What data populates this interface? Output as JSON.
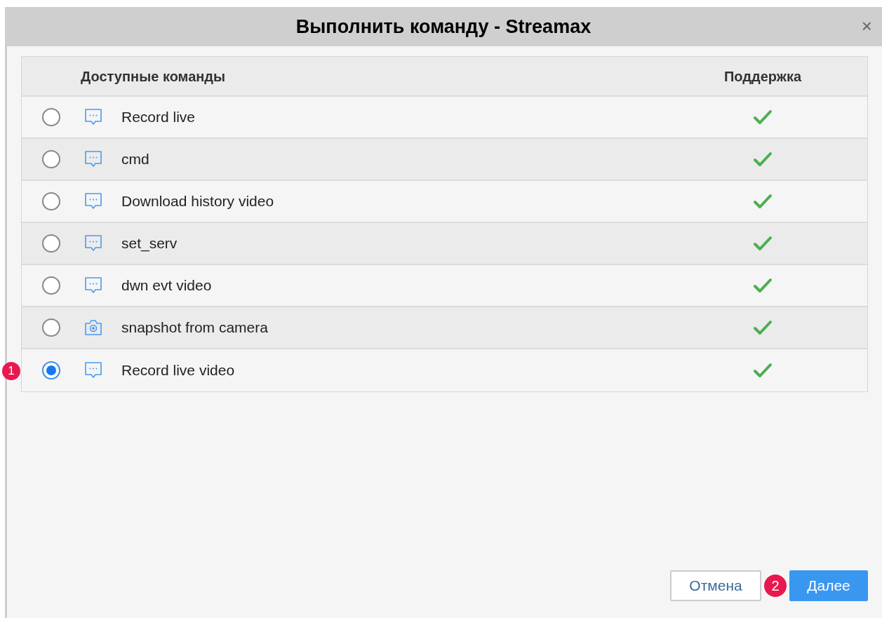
{
  "window": {
    "title": "Выполнить команду - Streamax",
    "close": "×"
  },
  "table": {
    "columns": [
      "Доступные команды",
      "Поддержка"
    ],
    "rows": [
      {
        "selected": false,
        "kind": "chat",
        "name": "Record live",
        "supported": true
      },
      {
        "selected": false,
        "kind": "chat",
        "name": "cmd",
        "supported": true
      },
      {
        "selected": false,
        "kind": "chat",
        "name": "Download history video",
        "supported": true
      },
      {
        "selected": false,
        "kind": "chat",
        "name": "set_serv",
        "supported": true
      },
      {
        "selected": false,
        "kind": "chat",
        "name": "dwn evt video",
        "supported": true
      },
      {
        "selected": false,
        "kind": "camera",
        "name": "snapshot from camera",
        "supported": true
      },
      {
        "selected": true,
        "kind": "chat",
        "name": "Record live video",
        "supported": true,
        "marker": "1"
      }
    ]
  },
  "buttons": [
    {
      "label": "Отмена",
      "kind": "secondary"
    },
    {
      "label": "Далее",
      "kind": "primary",
      "marker": "2"
    }
  ]
}
